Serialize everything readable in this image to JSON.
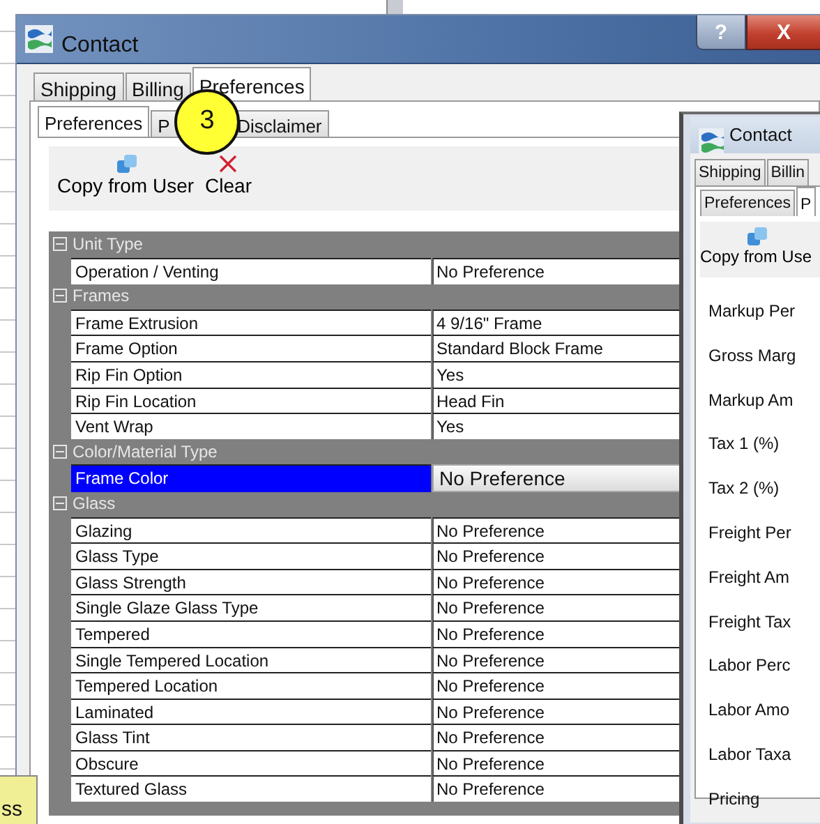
{
  "background_note": {
    "text": "ss"
  },
  "window": {
    "title": "Contact",
    "help_button": "?",
    "close_button": "X"
  },
  "tabs": [
    {
      "label": "Shipping",
      "selected": false
    },
    {
      "label": "Billing",
      "selected": false
    },
    {
      "label": "Preferences",
      "selected": true
    }
  ],
  "subtabs": [
    {
      "label": "Preferences",
      "selected": true
    },
    {
      "label": "P",
      "selected": false
    },
    {
      "label": "Disclaimer",
      "selected": false
    }
  ],
  "callout": "3",
  "toolbar": [
    {
      "label": "Copy from User",
      "kind": "copy"
    },
    {
      "label": "Clear",
      "kind": "clear"
    }
  ],
  "property_grid": [
    {
      "title": "Unit Type",
      "expanded": true,
      "rows": [
        {
          "name": "Operation / Venting",
          "value": "No Preference",
          "selected": false
        }
      ]
    },
    {
      "title": "Frames",
      "expanded": true,
      "rows": [
        {
          "name": "Frame Extrusion",
          "value": "4 9/16\" Frame",
          "selected": false
        },
        {
          "name": "Frame Option",
          "value": "Standard Block Frame",
          "selected": false
        },
        {
          "name": "Rip Fin Option",
          "value": "Yes",
          "selected": false
        },
        {
          "name": "Rip Fin Location",
          "value": "Head Fin",
          "selected": false
        },
        {
          "name": "Vent Wrap",
          "value": "Yes",
          "selected": false
        }
      ]
    },
    {
      "title": "Color/Material Type",
      "expanded": true,
      "rows": [
        {
          "name": "Frame Color",
          "value": "No Preference",
          "selected": true
        }
      ]
    },
    {
      "title": "Glass",
      "expanded": true,
      "rows": [
        {
          "name": "Glazing",
          "value": "No Preference",
          "selected": false
        },
        {
          "name": "Glass Type",
          "value": "No Preference",
          "selected": false
        },
        {
          "name": "Glass Strength",
          "value": "No Preference",
          "selected": false
        },
        {
          "name": "Single Glaze Glass Type",
          "value": "No Preference",
          "selected": false
        },
        {
          "name": "Tempered",
          "value": "No Preference",
          "selected": false
        },
        {
          "name": "Single Tempered Location",
          "value": "No Preference",
          "selected": false
        },
        {
          "name": "Tempered Location",
          "value": "No Preference",
          "selected": false
        },
        {
          "name": "Laminated",
          "value": "No Preference",
          "selected": false
        },
        {
          "name": "Glass Tint",
          "value": "No Preference",
          "selected": false
        },
        {
          "name": "Obscure",
          "value": "No Preference",
          "selected": false
        },
        {
          "name": "Textured Glass",
          "value": "No Preference",
          "selected": false
        }
      ]
    }
  ],
  "second_window": {
    "title": "Contact",
    "tabs": [
      {
        "label": "Shipping",
        "selected": false
      },
      {
        "label": "Billin",
        "selected": false
      }
    ],
    "subtabs": [
      {
        "label": "Preferences",
        "selected": false
      },
      {
        "label": "P",
        "selected": true
      }
    ],
    "toolbar": [
      {
        "label": "Copy from Use",
        "kind": "copy"
      }
    ],
    "fields": [
      "Markup Per",
      "Gross Marg",
      "Markup Am",
      "Tax 1 (%)",
      "Tax 2 (%)",
      "Freight Per",
      "Freight Am",
      "Freight Tax",
      "Labor Perc",
      "Labor Amo",
      "Labor Taxa",
      "Pricing"
    ]
  }
}
